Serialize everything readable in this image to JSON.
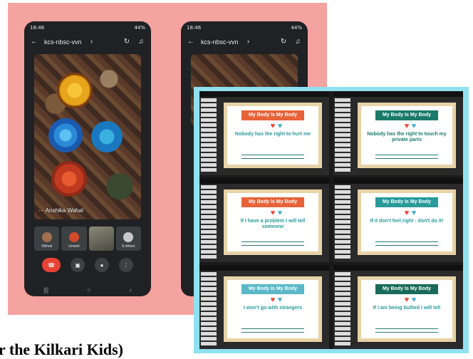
{
  "phone1": {
    "status_time": "18:46",
    "status_battery": "44%",
    "meeting_code": "kcs-nbsc-vvn",
    "speaker_name": "Anshika Wahal",
    "tiles": [
      {
        "label": "Vibhuti"
      },
      {
        "label": "Umesh"
      },
      {
        "label": ""
      },
      {
        "label": "6 others"
      }
    ]
  },
  "phone2": {
    "status_time": "18:46",
    "status_battery": "44%",
    "meeting_code": "kcs-nbsc-vvn"
  },
  "slides": [
    {
      "header": "My Body Is My Body",
      "body": "Nobody has the right to hurt me",
      "header_color": "#e8623a",
      "body_color": "#2a9a9a"
    },
    {
      "header": "My Body Is My Body",
      "body": "Nobody has the right to touch my private parts",
      "header_color": "#1a7a6a",
      "body_color": "#1a7a6a"
    },
    {
      "header": "My Body Is My Body",
      "body": "If I have a problem I will tell someone",
      "header_color": "#e8623a",
      "body_color": "#2a9a9a"
    },
    {
      "header": "My Body Is My Body",
      "body": "If it don't feel right - don't do it!",
      "header_color": "#2a9a9a",
      "body_color": "#2a9a9a"
    },
    {
      "header": "My Body Is My Body",
      "body": "I won't go with strangers",
      "header_color": "#5ab8c8",
      "body_color": "#2a9a9a"
    },
    {
      "header": "My Body Is My Body",
      "body": "If I am being bullied I will tell",
      "header_color": "#1a6a5a",
      "body_color": "#2a9a9a"
    }
  ],
  "caption": "r the Kilkari Kids)"
}
